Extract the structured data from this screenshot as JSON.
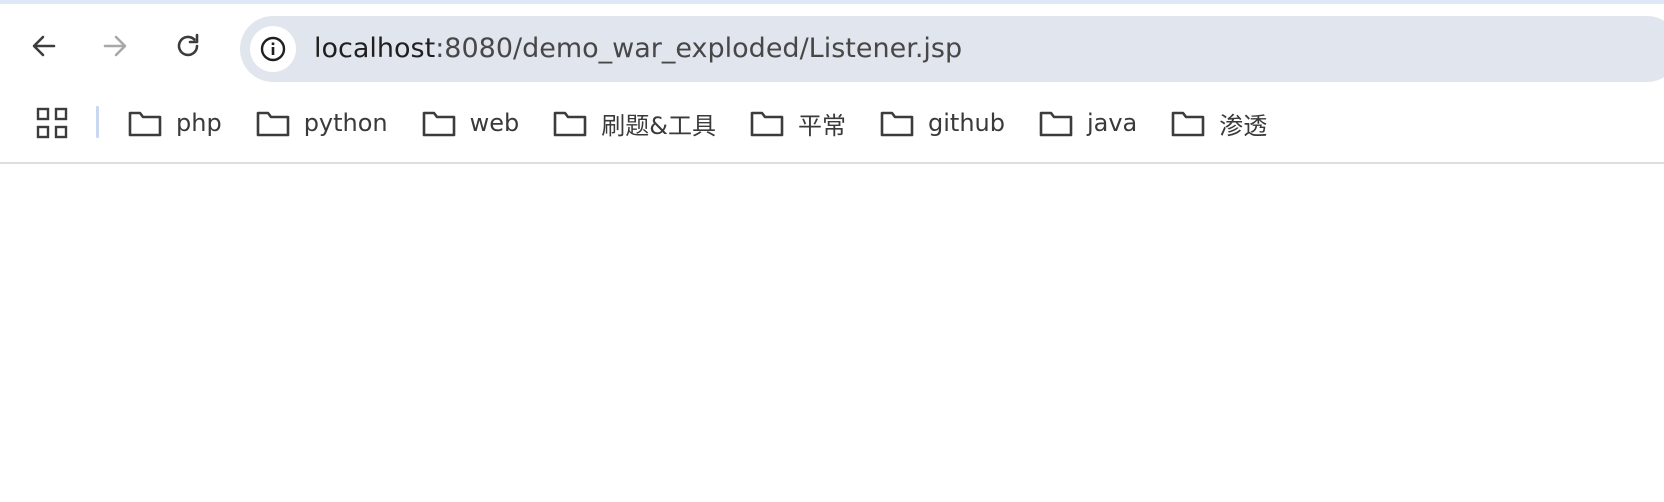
{
  "toolbar": {
    "back_icon": "arrow-left-icon",
    "forward_icon": "arrow-right-icon",
    "reload_icon": "reload-icon",
    "site_info_icon": "info-icon"
  },
  "omnibox": {
    "url_host": "localhost",
    "url_rest": ":8080/demo_war_exploded/Listener.jsp"
  },
  "bookmarks_bar": {
    "apps_icon": "apps-grid-icon",
    "items": [
      {
        "label": "php",
        "icon": "folder-icon"
      },
      {
        "label": "python",
        "icon": "folder-icon"
      },
      {
        "label": "web",
        "icon": "folder-icon"
      },
      {
        "label": "刷题&工具",
        "icon": "folder-icon"
      },
      {
        "label": "平常",
        "icon": "folder-icon"
      },
      {
        "label": "github",
        "icon": "folder-icon"
      },
      {
        "label": "java",
        "icon": "folder-icon"
      },
      {
        "label": "渗透",
        "icon": "folder-icon"
      }
    ]
  },
  "colors": {
    "omnibox_bg": "#e1e6ee",
    "top_accent": "#dde8f8",
    "separator": "#c7d8f0",
    "text": "#3a3a3a",
    "disabled_icon": "#a8a8a8"
  }
}
